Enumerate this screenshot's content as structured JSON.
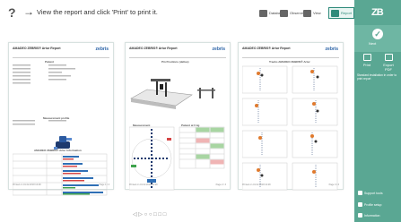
{
  "toolbar": {
    "help": "?",
    "arrow": "→",
    "instruction": "View the report and click 'Print' to print it.",
    "buttons": [
      {
        "label": "Database"
      },
      {
        "label": "Observe"
      },
      {
        "label": "View"
      },
      {
        "label": "Report"
      }
    ]
  },
  "right_panel": {
    "logo": "ZB",
    "next_label": "Next",
    "next_symbol": "✓",
    "print_label": "Print",
    "export_label": "Export PDF",
    "info_text": "Standard installation in order to print report",
    "bottom_items": [
      {
        "label": "Support tools"
      },
      {
        "label": "Profile setup"
      },
      {
        "label": "Information"
      }
    ]
  },
  "pages": [
    {
      "title": "AMADEO ZEBRIS® Artur Report",
      "logo": "zebris",
      "section1": "Patient",
      "section2": "Measurement profile",
      "section3": "AMADEO ZEBRIS® Artur Information",
      "footer_left": "Printed on 01.02.2018 10:28",
      "footer_right": "Page 1 / 3"
    },
    {
      "title": "AMADEO ZEBRIS® Artur Report",
      "logo": "zebris",
      "section1": "Pin Positions (deltas)",
      "section2": "Measurement",
      "section3": "Patient at 0 kg",
      "footer_left": "Printed on 01.02.2018 10:28",
      "footer_right": "Page 2 / 3"
    },
    {
      "title": "AMADEO ZEBRIS® Artur Report",
      "logo": "zebris",
      "section1": "Tracks AMADEO ZEBRIS® Artur",
      "footer_left": "Printed on 01.02.2018 10:28",
      "footer_right": "Page 3 / 3"
    }
  ],
  "pager": "◁ ▷  ○ ○  □ □ □"
}
